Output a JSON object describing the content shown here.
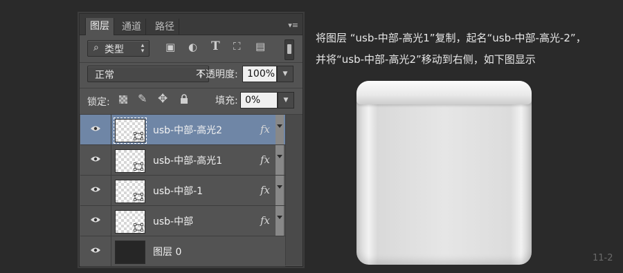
{
  "panel": {
    "tabs": [
      "图层",
      "通道",
      "路径"
    ],
    "filter_label": "类型",
    "blend_mode": "正常",
    "opacity_label": "不透明度:",
    "opacity_value": "100%",
    "lock_label": "锁定:",
    "fill_label": "填充:",
    "fill_value": "0%",
    "fx_label": "fx",
    "layers": [
      {
        "name": "usb-中部-高光2",
        "selected": true,
        "fx": true
      },
      {
        "name": "usb-中部-高光1",
        "selected": false,
        "fx": true
      },
      {
        "name": "usb-中部-1",
        "selected": false,
        "fx": true
      },
      {
        "name": "usb-中部",
        "selected": false,
        "fx": true
      },
      {
        "name": "图层 0",
        "selected": false,
        "fx": false
      }
    ]
  },
  "description": {
    "line1": "将图层 “usb-中部-高光1”复制，起名“usb-中部-高光-2”，",
    "line2": "并将“usb-中部-高光2”移动到右侧，如下图显示"
  },
  "figure_number": "11-2",
  "colors": {
    "background": "#2a2a2a",
    "panel": "#535353",
    "selected_layer": "#6f86a6"
  }
}
